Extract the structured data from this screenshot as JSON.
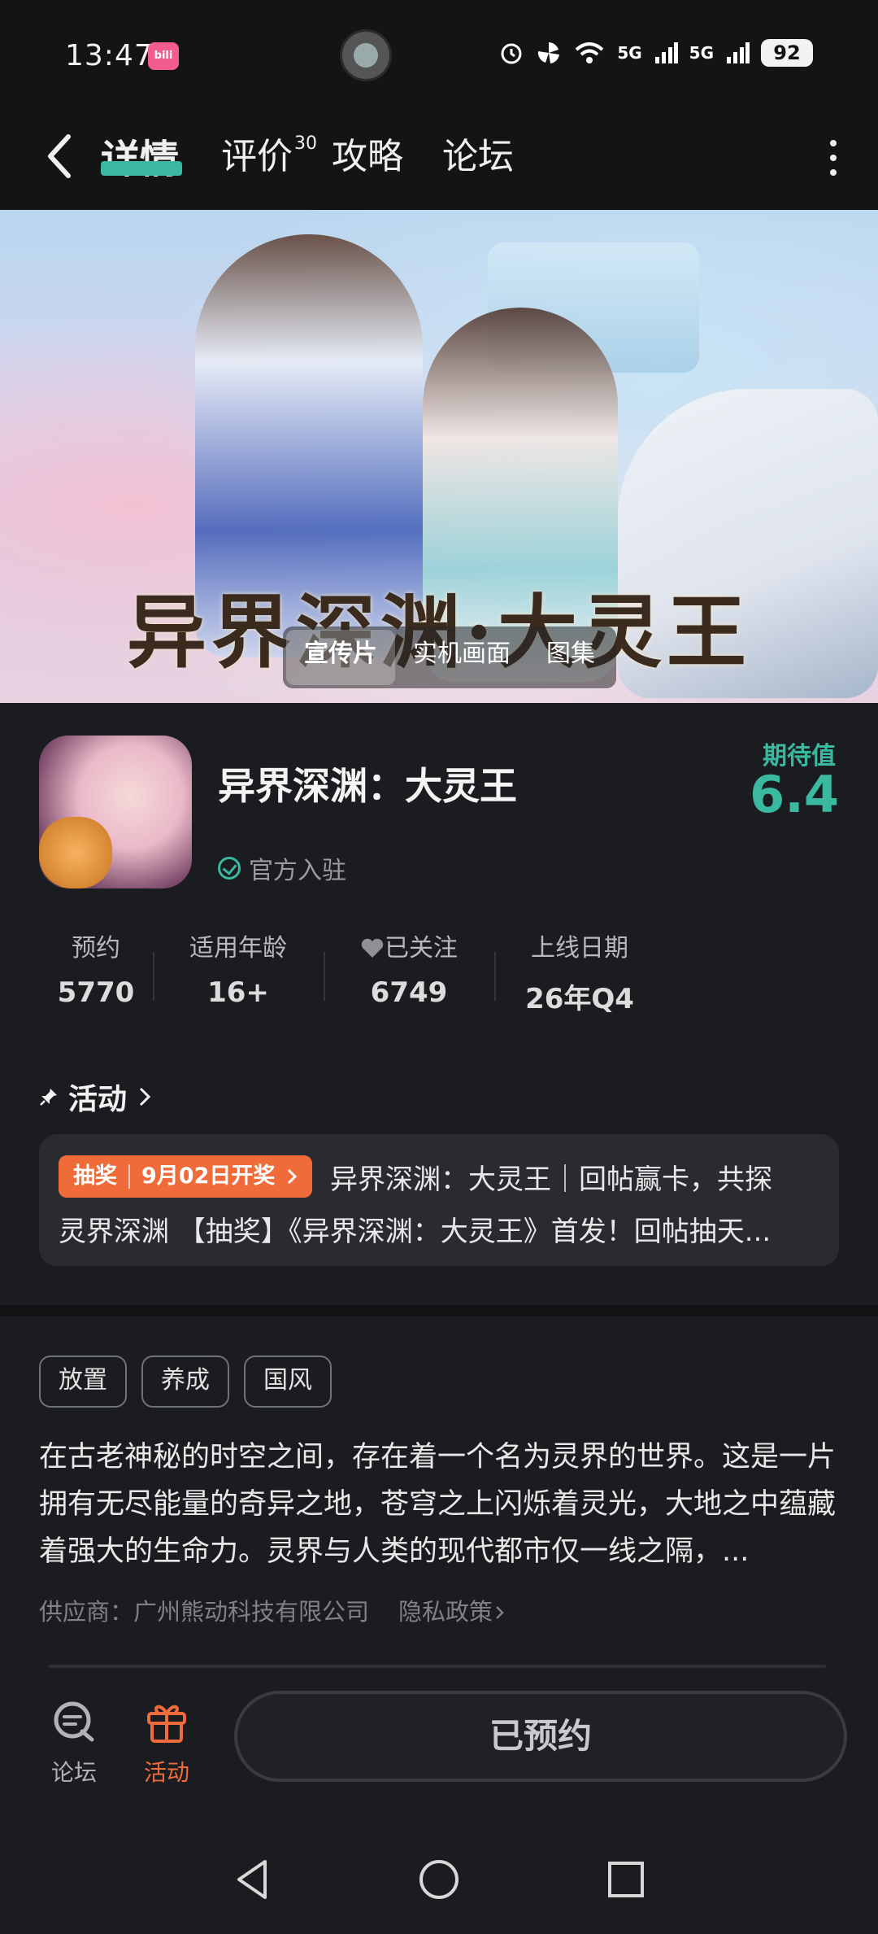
{
  "status_bar": {
    "time": "13:47",
    "app_badge": "bilibili",
    "signal_1": "5G",
    "signal_2": "5G",
    "battery": "92"
  },
  "nav": {
    "tabs": [
      {
        "label": "详情"
      },
      {
        "label": "评价",
        "count": "30"
      },
      {
        "label": "攻略"
      },
      {
        "label": "论坛"
      }
    ]
  },
  "hero": {
    "title_art": "异界深渊·大灵王",
    "media_tabs": [
      "宣传片",
      "实机画面",
      "图集"
    ]
  },
  "app": {
    "name": "异界深渊：大灵王",
    "official": "官方入驻",
    "expect_label": "期待值",
    "expect_value": "6.4"
  },
  "stats": [
    {
      "label": "预约",
      "value": "5770"
    },
    {
      "label": "适用年龄",
      "value": "16+"
    },
    {
      "label": "已关注",
      "value": "6749"
    },
    {
      "label": "上线日期",
      "value": "26年Q4"
    }
  ],
  "activity": {
    "title": "活动",
    "badge_type": "抽奖",
    "badge_date": "9月02日开奖",
    "line1": "异界深渊：大灵王｜回帖赢卡，共探",
    "line2": "灵界深渊 【抽奖】《异界深渊：大灵王》首发！回帖抽天..."
  },
  "tags": [
    "放置",
    "养成",
    "国风"
  ],
  "description": "在古老神秘的时空之间，存在着一个名为灵界的世界。这是一片拥有无尽能量的奇异之地，苍穹之上闪烁着灵光，大地之中蕴藏着强大的生命力。灵界与人类的现代都市仅一线之隔，...",
  "vendor": {
    "label": "供应商：广州熊动科技有限公司",
    "privacy": "隐私政策"
  },
  "bottom_bar": {
    "forum": "论坛",
    "activity": "活动",
    "reserve_button": "已预约"
  },
  "colors": {
    "accent": "#3bb8a0",
    "orange": "#ef6b3a",
    "background": "#1b1c20"
  }
}
